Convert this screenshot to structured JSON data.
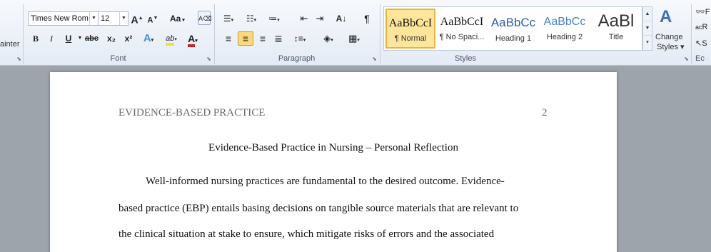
{
  "clipboard": {
    "painter_label": "ainter"
  },
  "font": {
    "group_label": "Font",
    "font_name": "Times New Rom",
    "font_size": "12",
    "grow_label": "A",
    "shrink_label": "A",
    "case_label": "Aa",
    "bold_label": "B",
    "italic_label": "I",
    "underline_label": "U",
    "strike_label": "abc",
    "subscript_label": "x₂",
    "superscript_label": "x²",
    "highlight_label": "ab",
    "font_color_label": "A"
  },
  "paragraph": {
    "group_label": "Paragraph",
    "pilcrow": "¶"
  },
  "styles": {
    "group_label": "Styles",
    "tiles": [
      {
        "sample": "AaBbCcI",
        "name": "¶ Normal"
      },
      {
        "sample": "AaBbCcI",
        "name": "¶ No Spaci..."
      },
      {
        "sample": "AaBbCc",
        "name": "Heading 1"
      },
      {
        "sample": "AaBbCc",
        "name": "Heading 2"
      },
      {
        "sample": "AaBl",
        "name": "Title"
      }
    ],
    "change_styles_label_1": "Change",
    "change_styles_label_2": "Styles ▾"
  },
  "editing": {
    "group_label": "Ec",
    "find_label": "F",
    "replace_label": "R",
    "select_label": "S"
  },
  "document": {
    "header_title": "EVIDENCE-BASED PRACTICE",
    "page_number": "2",
    "heading": "Evidence-Based Practice in Nursing – Personal Reflection",
    "lines": [
      "Well-informed nursing practices are fundamental to the desired outcome. Evidence-",
      "based practice (EBP) entails basing decisions on tangible source materials that are relevant to",
      "the clinical situation at stake to ensure, which mitigate risks of errors and the associated"
    ]
  },
  "colors": {
    "accent_highlight": "#f5e02a",
    "font_color_red": "#d21f1f",
    "heading_blue": "#2a5db0"
  }
}
